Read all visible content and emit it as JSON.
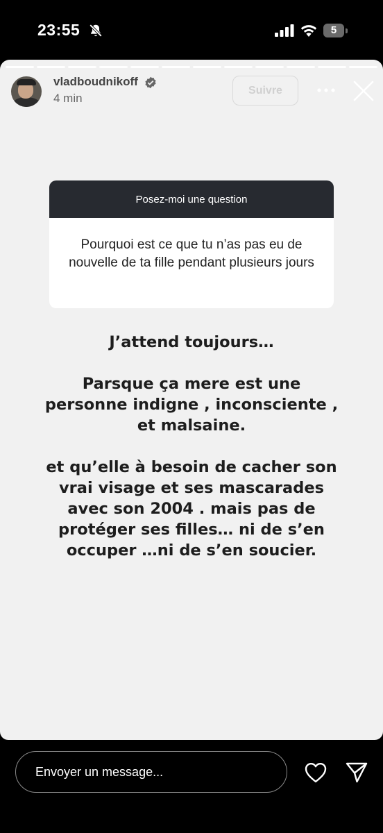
{
  "status_bar": {
    "time": "23:55",
    "battery_level": "5",
    "icons": [
      "bell-slash-icon",
      "signal-icon",
      "wifi-icon",
      "battery-icon"
    ]
  },
  "story": {
    "progress_segments": 12,
    "user": {
      "username": "vladboudnikoff",
      "verified": true,
      "time_ago": "4 min"
    },
    "follow_label": "Suivre",
    "question": {
      "header": "Posez-moi une question",
      "text": "Pourquoi est ce que tu n’as pas eu de nouvelle de ta fille pendant plusieurs jours"
    },
    "answer_text": "J’attend toujours…\n\nParsque ça mere  est une personne indigne , inconsciente , et malsaine.\n\net qu’elle à besoin de cacher son vrai visage et ses mascarades avec son 2004 . mais pas de protéger ses filles… ni de s’en occuper …ni de s’en soucier."
  },
  "reply_bar": {
    "placeholder": "Envoyer un message..."
  },
  "colors": {
    "background": "#000000",
    "story_background": "#f1f1f1",
    "question_header": "#272a30",
    "text_dark": "#1d1d1d"
  }
}
